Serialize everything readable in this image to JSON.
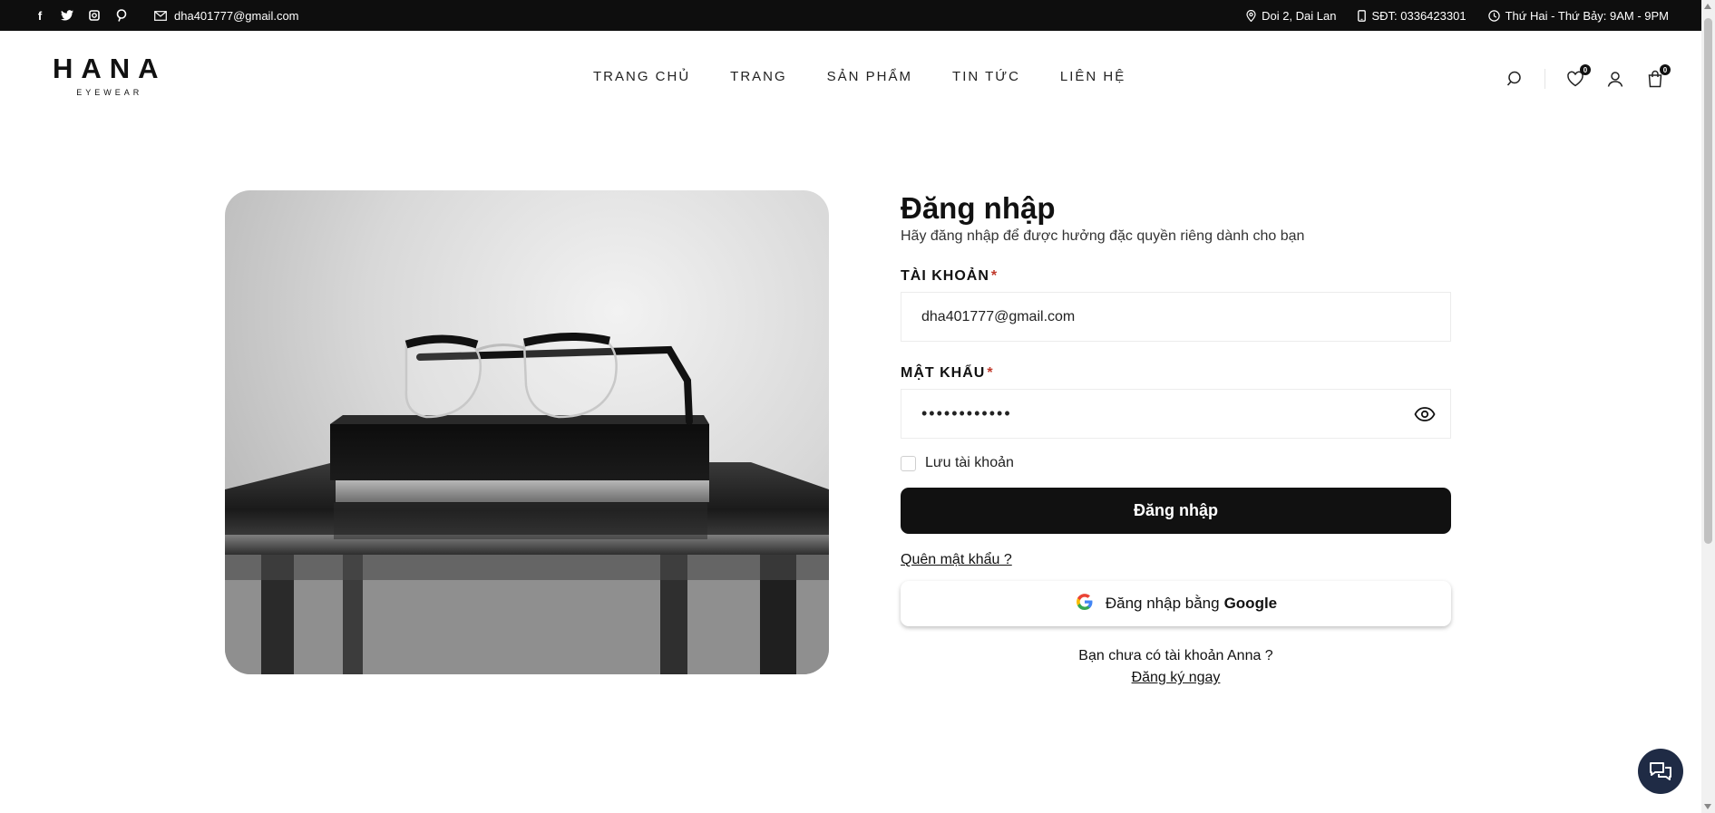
{
  "topbar": {
    "socials": [
      {
        "icon": "facebook-icon",
        "glyph": "f"
      },
      {
        "icon": "twitter-icon",
        "glyph": ""
      },
      {
        "icon": "instagram-icon",
        "glyph": ""
      },
      {
        "icon": "pinterest-icon",
        "glyph": ""
      }
    ],
    "email": "dha401777@gmail.com",
    "address": "Doi 2, Dai Lan",
    "phone": "SĐT: 0336423301",
    "hours": "Thứ Hai - Thứ Bảy: 9AM - 9PM"
  },
  "header": {
    "logo_brand": "HANA",
    "logo_sub": "EYEWEAR",
    "nav": [
      "TRANG CHỦ",
      "TRANG",
      "SẢN PHẨM",
      "TIN TỨC",
      "LIÊN HỆ"
    ],
    "wishlist_count": "0",
    "cart_count": "0"
  },
  "login": {
    "title": "Đăng nhập",
    "subtitle": "Hãy đăng nhập để được hưởng đặc quyền riêng dành cho bạn",
    "account_label": "TÀI KHOẢN",
    "account_value": "dha401777@gmail.com",
    "password_label": "MẬT KHẨU",
    "password_value": "••••••••••••",
    "required_mark": "*",
    "remember_label": "Lưu tài khoản",
    "remember_checked": false,
    "submit_label": "Đăng nhập",
    "forgot_label": "Quên mật khẩu ?",
    "google_prefix": "Đăng nhập bằng",
    "google_brand": "Google",
    "no_account_text": "Bạn chưa có tài khoản Anna ?",
    "signup_label": "Đăng ký ngay"
  },
  "colors": {
    "topbar_bg": "#0e0e0e",
    "button_bg": "#111111",
    "required": "#c0392b",
    "chat_bg": "#1f2b45"
  }
}
